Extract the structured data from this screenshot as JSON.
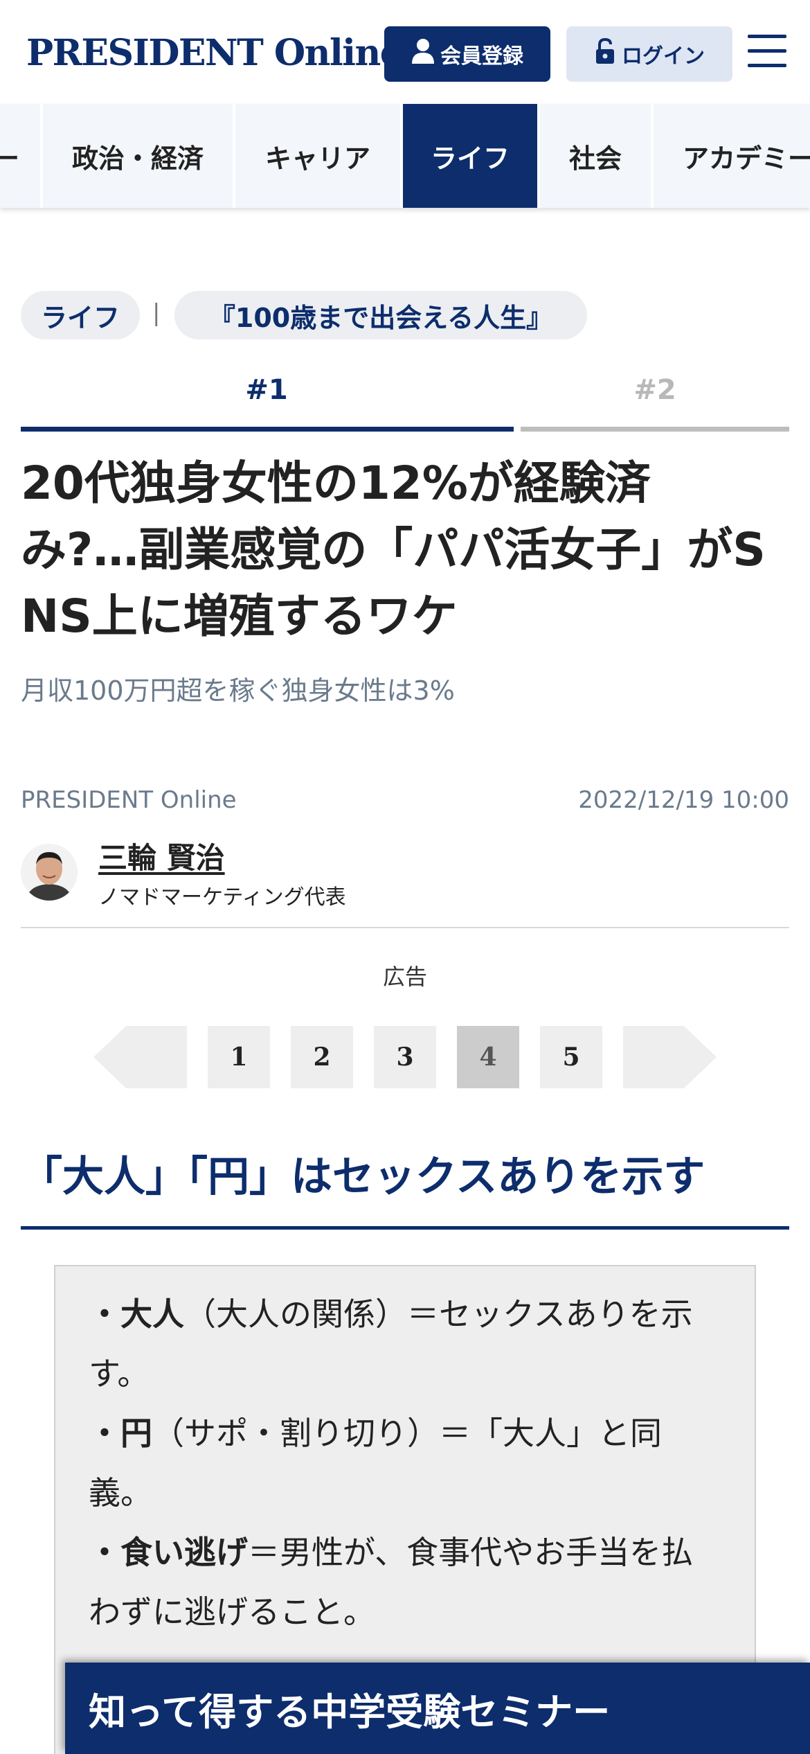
{
  "header": {
    "logo": "PRESIDENT Online",
    "register_label": "会員登録",
    "login_label": "ログイン",
    "icons": [
      "person-icon",
      "lock-icon",
      "menu-icon"
    ]
  },
  "categories": [
    {
      "label": "ー",
      "active": false
    },
    {
      "label": "政治・経済",
      "active": false
    },
    {
      "label": "キャリア",
      "active": false
    },
    {
      "label": "ライフ",
      "active": true
    },
    {
      "label": "社会",
      "active": false
    },
    {
      "label": "アカデミー",
      "active": false
    }
  ],
  "tags": {
    "category": "ライフ",
    "separator": "|",
    "series": "『100歳まで出会える人生』"
  },
  "series_tabs": [
    {
      "label": "#1",
      "active": true
    },
    {
      "label": "#2",
      "active": false
    }
  ],
  "article": {
    "title_lines": [
      "20代独身女性の12%が経験済",
      "み?…副業感覚の「パパ活女子」がS",
      "NS上に増殖するワケ"
    ],
    "subtitle": "月収100万円超を稼ぐ独身女性は3%",
    "source": "PRESIDENT Online",
    "date": "2022/12/19 10:00",
    "author": {
      "name": "三輪 賢治",
      "role": "ノマドマーケティング代表"
    },
    "ad_label": "広告"
  },
  "pagination": {
    "pages": [
      "1",
      "2",
      "3",
      "4",
      "5"
    ],
    "current": "4"
  },
  "section": {
    "heading": "「大人」「円」はセックスありを示す",
    "glossary": [
      {
        "term": "・大人",
        "desc_lines": [
          "（大人の関係）＝セックスありを示",
          "す。"
        ]
      },
      {
        "term": "・円",
        "desc_lines": [
          "（サポ・割り切り）＝「大人」と同",
          "義。"
        ]
      },
      {
        "term": "・食い逃げ",
        "desc_lines": [
          "＝男性が、食事代やお手当を払",
          "わずに逃げること。"
        ]
      }
    ]
  },
  "banner": {
    "label": "知って得する中学受験セミナー"
  },
  "colors": {
    "brand": "#0d2d6c",
    "tab_inactive": "#f3f6fb",
    "muted_text": "#6a7a8c"
  }
}
